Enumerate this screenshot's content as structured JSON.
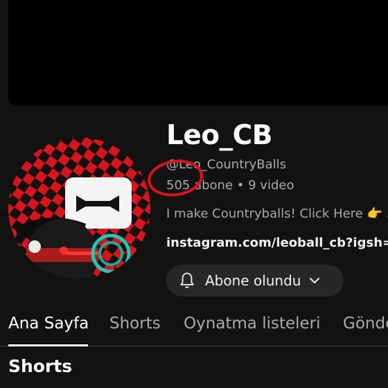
{
  "channel": {
    "name": "Leo_CB",
    "handle": "@Leo_CountryBalls",
    "subscribers": "505 abone",
    "separator": "•",
    "videos": "9 video",
    "description": "I make Countryballs! Click Here 👉 ...",
    "link": "instagram.com/leoball_cb?igsh=MXZ"
  },
  "subscribe_button": {
    "label": "Abone olundu",
    "icon": "bell-icon",
    "dropdown_icon": "chevron-down-icon"
  },
  "tabs": [
    {
      "label": "Ana Sayfa",
      "active": true
    },
    {
      "label": "Shorts",
      "active": false
    },
    {
      "label": "Oynatma listeleri",
      "active": false
    },
    {
      "label": "Gönderiler",
      "active": false
    }
  ],
  "section": {
    "title": "Shorts"
  },
  "colors": {
    "background": "#121212",
    "button_bg": "#272727",
    "annotation": "#e0101a",
    "muted_text": "#aaaaaa"
  }
}
